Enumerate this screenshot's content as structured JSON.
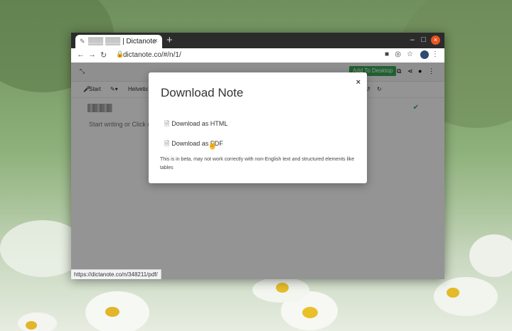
{
  "browser": {
    "tab_title": "▒▒▒ ▒▒▒ | Dictanote",
    "url": "dictanote.co/#/n/1/",
    "status_url": "https://dictanote.co/n/348211/pdf/"
  },
  "app": {
    "add_to_desktop_label": "Add To Desktop",
    "start_label": "Start",
    "font_label": "Helvetica",
    "placeholder": "Start writing or Click on"
  },
  "modal": {
    "title": "Download Note",
    "close_label": "×",
    "option_html": "Download as HTML",
    "option_pdf": "Download as PDF",
    "note": "This is in beta, may not work correctly with non-English text and structured elements like tables"
  },
  "colors": {
    "accent_green": "#3aa655",
    "window_close": "#e95420"
  }
}
